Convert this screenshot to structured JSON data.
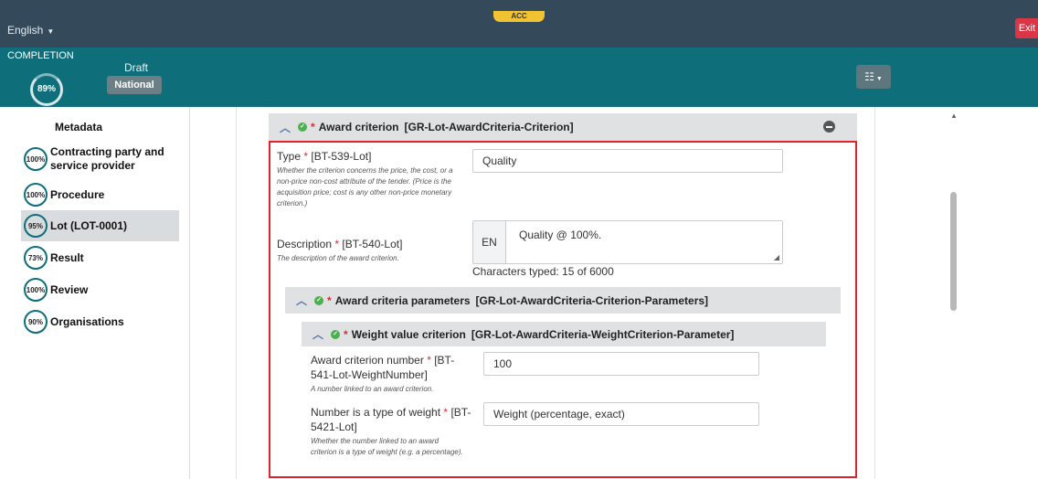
{
  "header": {
    "language": "English",
    "env_badge": "ACC",
    "exit_label": "Exit"
  },
  "status": {
    "completion_label": "COMPLETION",
    "completion_percent": "89%",
    "draft_label": "Draft",
    "scope_label": "National"
  },
  "sidebar": {
    "items": [
      {
        "label": "Metadata",
        "percent": ""
      },
      {
        "label": "Contracting party and service provider",
        "percent": "100%"
      },
      {
        "label": "Procedure",
        "percent": "100%"
      },
      {
        "label": "Lot (LOT-0001)",
        "percent": "95%"
      },
      {
        "label": "Result",
        "percent": "73%"
      },
      {
        "label": "Review",
        "percent": "100%"
      },
      {
        "label": "Organisations",
        "percent": "90%"
      }
    ]
  },
  "award_criterion": {
    "title": "Award criterion",
    "group_id": "[GR-Lot-AwardCriteria-Criterion]",
    "type": {
      "label": "Type",
      "code": "[BT-539-Lot]",
      "help": "Whether the criterion concerns the price, the cost, or a non-price non-cost attribute of the tender. (Price is the acquisition price; cost is any other non-price monetary criterion.)",
      "value": "Quality"
    },
    "description": {
      "label": "Description",
      "code": "[BT-540-Lot]",
      "help": "The description of the award criterion.",
      "lang": "EN",
      "value": "Quality @ 100%.",
      "char_count": "Characters typed: 15 of 6000"
    }
  },
  "parameters": {
    "title": "Award criteria parameters",
    "group_id": "[GR-Lot-AwardCriteria-Criterion-Parameters]"
  },
  "weight": {
    "title": "Weight value criterion",
    "group_id": "[GR-Lot-AwardCriteria-WeightCriterion-Parameter]",
    "number": {
      "label": "Award criterion number",
      "code": "[BT-541-Lot-WeightNumber]",
      "help": "A number linked to an award criterion.",
      "value": "100"
    },
    "type": {
      "label": "Number is a type of weight",
      "code": "[BT-5421-Lot]",
      "help": "Whether the number linked to an award criterion is a type of weight (e.g. a percentage).",
      "value": "Weight (percentage, exact)"
    }
  },
  "colors": {
    "topbar": "#34495a",
    "teal": "#0e6e7a",
    "highlight": "#e0232c",
    "exit": "#dc3545",
    "badge": "#f1c232"
  }
}
